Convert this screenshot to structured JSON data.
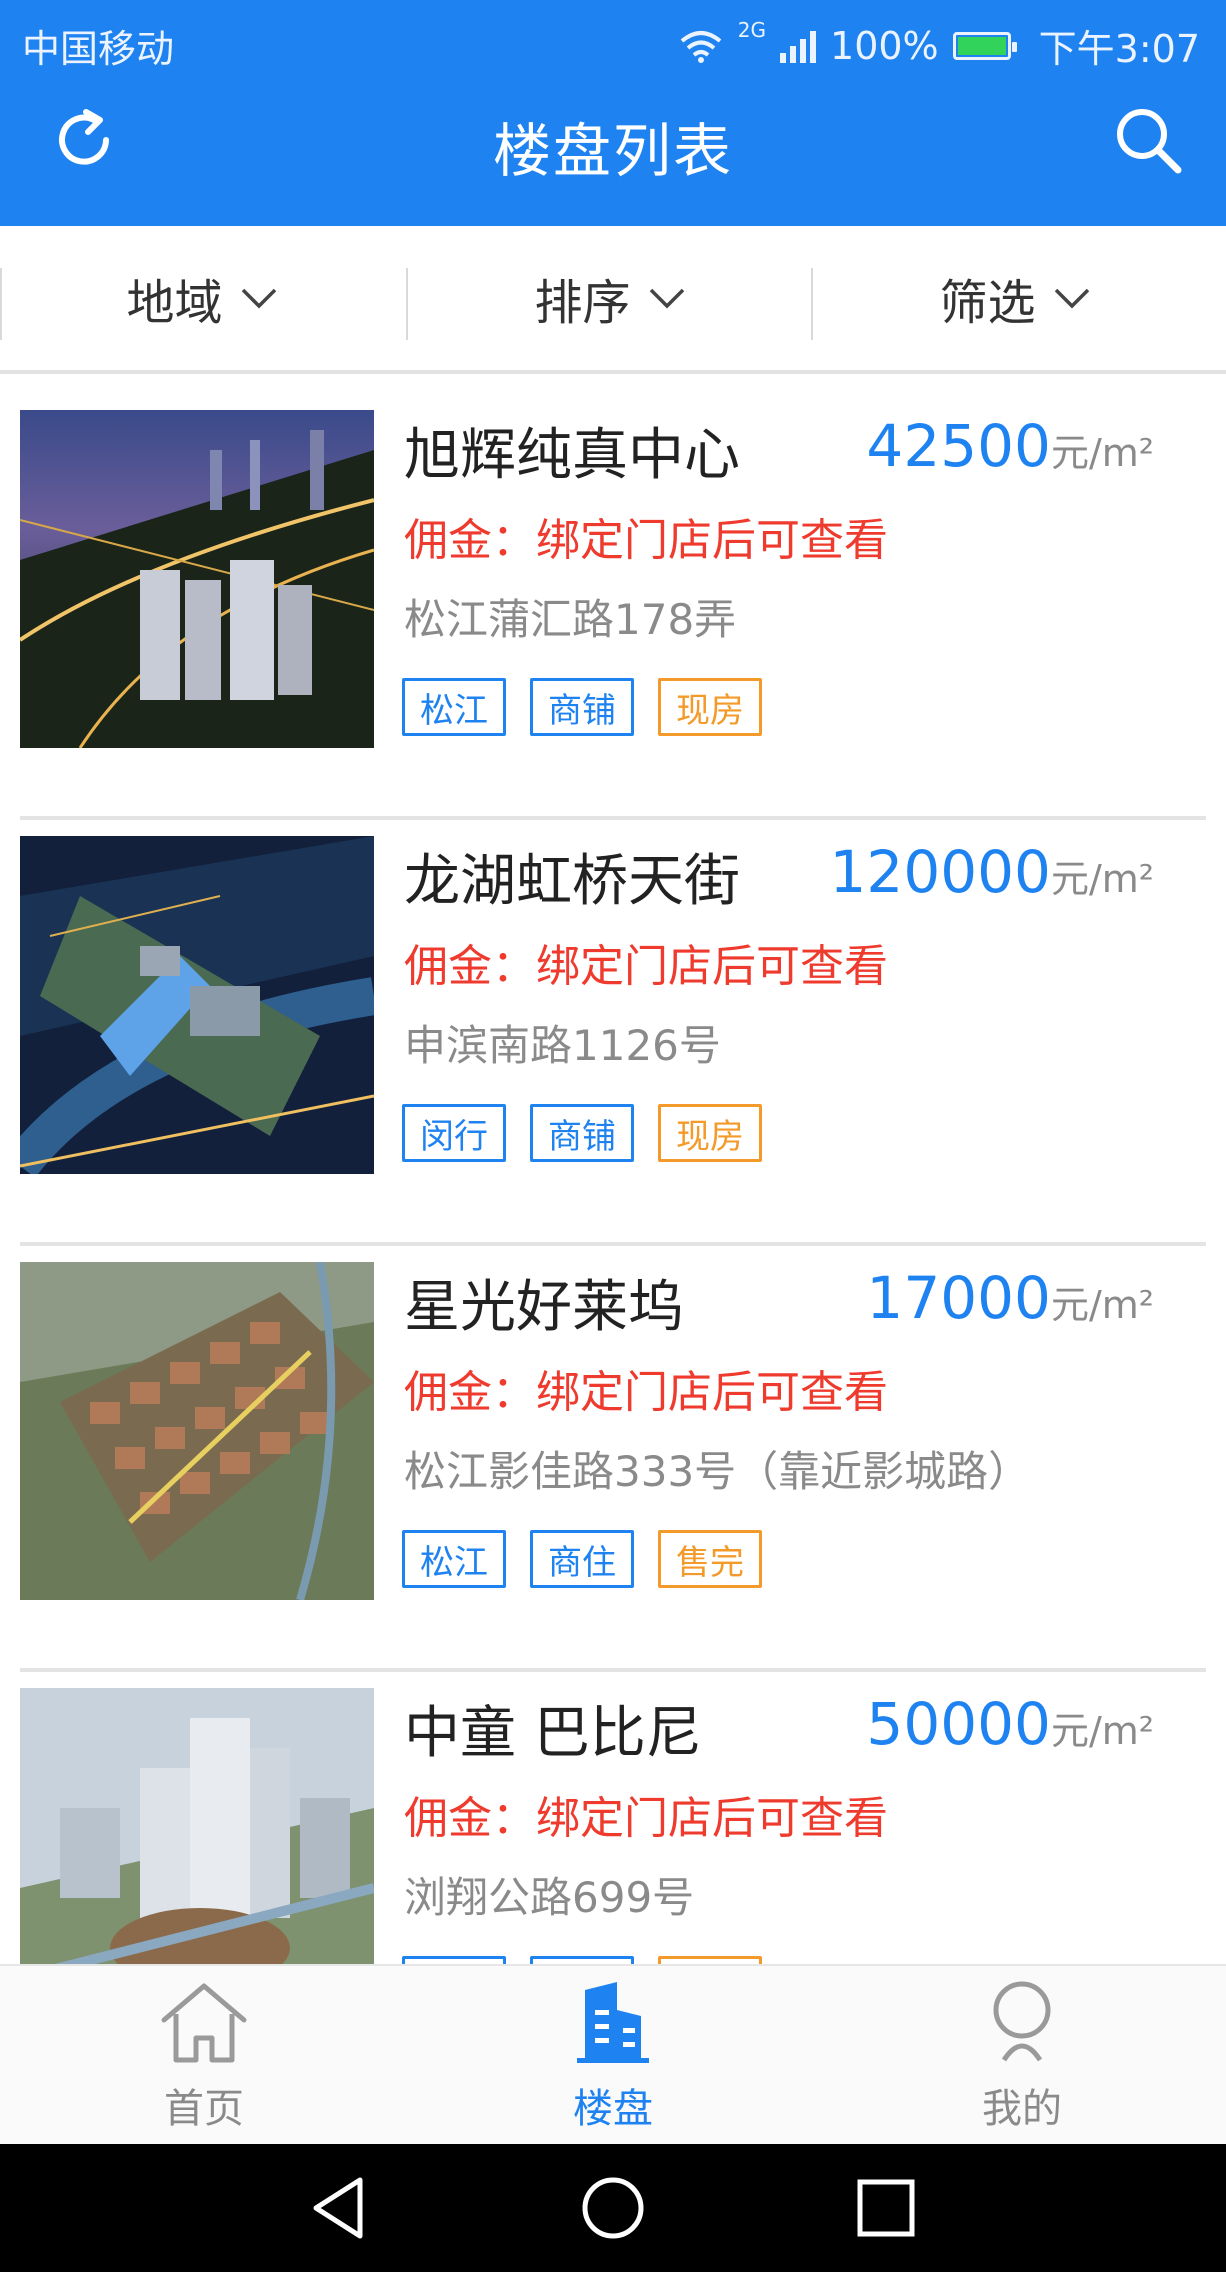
{
  "status_bar": {
    "carrier": "中国移动",
    "network": "2G",
    "battery": "100%",
    "time": "下午3:07"
  },
  "app_bar": {
    "title": "楼盘列表",
    "left_icon": "refresh-icon",
    "right_icon": "search-icon",
    "color": "#1e83f0"
  },
  "filters": [
    {
      "label": "地域"
    },
    {
      "label": "排序"
    },
    {
      "label": "筛选"
    }
  ],
  "listings": [
    {
      "name": "旭辉纯真中心",
      "price": "42500",
      "unit": "元/m²",
      "commission": "佣金：绑定门店后可查看",
      "address": "松江蒲汇路178弄",
      "tags": [
        {
          "text": "松江",
          "color": "blue"
        },
        {
          "text": "商铺",
          "color": "blue"
        },
        {
          "text": "现房",
          "color": "orange"
        }
      ]
    },
    {
      "name": "龙湖虹桥天街",
      "price": "120000",
      "unit": "元/m²",
      "commission": "佣金：绑定门店后可查看",
      "address": "申滨南路1126号",
      "tags": [
        {
          "text": "闵行",
          "color": "blue"
        },
        {
          "text": "商铺",
          "color": "blue"
        },
        {
          "text": "现房",
          "color": "orange"
        }
      ]
    },
    {
      "name": "星光好莱坞",
      "price": "17000",
      "unit": "元/m²",
      "commission": "佣金：绑定门店后可查看",
      "address": "松江影佳路333号（靠近影城路）",
      "tags": [
        {
          "text": "松江",
          "color": "blue"
        },
        {
          "text": "商住",
          "color": "blue"
        },
        {
          "text": "售完",
          "color": "orange"
        }
      ]
    },
    {
      "name": "中童 巴比尼",
      "price": "50000",
      "unit": "元/m²",
      "commission": "佣金：绑定门店后可查看",
      "address": "浏翔公路699号",
      "tags": []
    }
  ],
  "bottom_nav": [
    {
      "label": "首页",
      "icon": "home-icon",
      "active": false
    },
    {
      "label": "楼盘",
      "icon": "building-icon",
      "active": true
    },
    {
      "label": "我的",
      "icon": "person-icon",
      "active": false
    }
  ],
  "colors": {
    "accent": "#1e83f0",
    "commission": "#ef3a2e",
    "tag_blue": "#1e83f0",
    "tag_orange": "#f39a2a"
  }
}
